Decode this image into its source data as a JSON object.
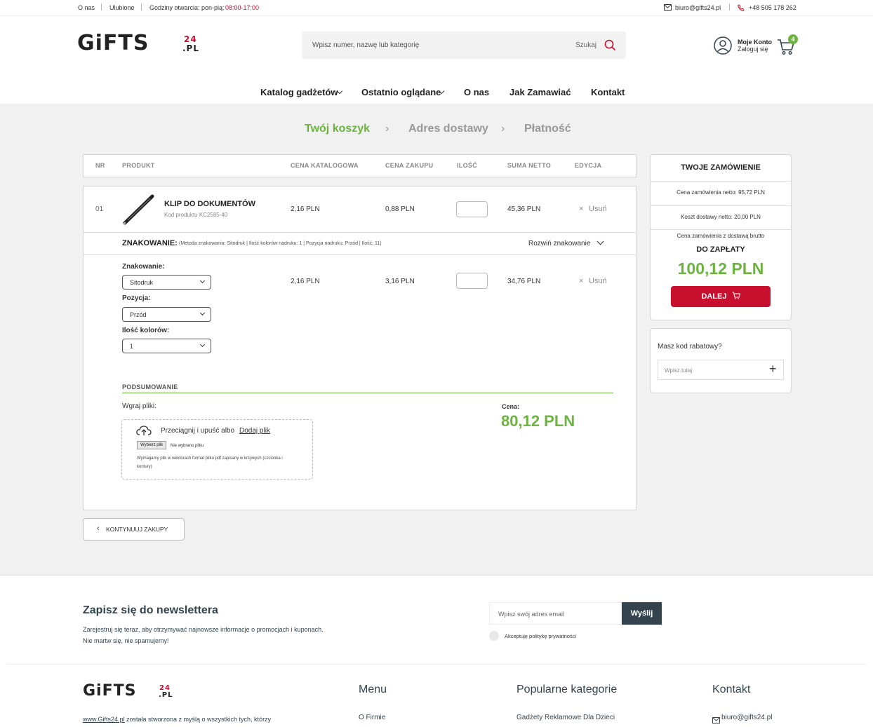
{
  "topbar": {
    "links": [
      "O nas",
      "Ulubione"
    ],
    "hours_label": "Godziny otwarcia: pon-pią:",
    "hours_value": "08:00-17:00",
    "email": "biuro@gifts24.pl",
    "phone": "+48 505 178 262"
  },
  "header": {
    "logo_main": "GiFTS",
    "logo_num": "24",
    "logo_pl": ".PL",
    "search_placeholder": "Wpisz numer, nazwę lub kategorię",
    "search_button": "Szukaj",
    "account_title": "Moje Konto",
    "account_sub": "Zaloguj się",
    "cart_count": "4"
  },
  "nav": [
    "Katalog gadżetów",
    "Ostatnio oglądane",
    "O nas",
    "Jak Zamawiać",
    "Kontakt"
  ],
  "steps": [
    "Twój koszyk",
    "Adres dostawy",
    "Płatność"
  ],
  "table": {
    "headers": [
      "NR",
      "PRODUKT",
      "CENA KATALOGOWA",
      "CENA ZAKUPU",
      "ILOŚĆ",
      "SUMA NETTO",
      "EDYCJA"
    ],
    "row": {
      "nr": "01",
      "name": "KLIP DO DOKUMENTÓW",
      "code": "Kod produktu KC2585-40",
      "catalog_price": "2,16 PLN",
      "purchase_price": "0,88 PLN",
      "sum": "45,36 PLN",
      "remove": "Usuń"
    },
    "marking": {
      "label": "ZNAKOWANIE:",
      "details": "(Metoda znakowania: Sitodruk | Ilość kolorów nadruku: 1 | Pozycja nadruku: Przód | Ilość: 11)",
      "expand": "Rozwiń znakowanie",
      "f1_label": "Znakowanie:",
      "f1_value": "Sitodruk",
      "f2_label": "Pozycja:",
      "f2_value": "Przód",
      "f3_label": "Ilość kolorów:",
      "f3_value": "1",
      "catalog_price": "2,16 PLN",
      "purchase_price": "3,16 PLN",
      "sum": "34,76 PLN",
      "remove": "Usuń"
    },
    "summary": {
      "title": "PODSUMOWANIE",
      "upload_label": "Wgraj pliki:",
      "drop_text": "Przeciągnij i upuść albo",
      "drop_link": "Dodaj plik",
      "choose_btn": "Wybierz plik",
      "no_file": "Nie wybrano pliku",
      "note_1": "Wymagamy plik w wektorach format pliku pdf zapisany w krzywych (czcionka i",
      "note_2": "kontury)",
      "price_label": "Cena:",
      "price": "80,12 PLN"
    },
    "continue": "KONTYNUUJ ZAKUPY"
  },
  "order": {
    "title": "TWOJE ZAMÓWIENIE",
    "net": "Cena zamówienia netto: 95,72 PLN",
    "delivery": "Koszt dostawy netto: 20,00 PLN",
    "gross_label": "Cena zamówienia z dostawą brutto",
    "pay_label": "DO ZAPŁATY",
    "total": "100,12 PLN",
    "button": "DALEJ"
  },
  "coupon": {
    "title": "Masz kod rabatowy?",
    "placeholder": "Wpisz tutaj"
  },
  "newsletter": {
    "title": "Zapisz się do newslettera",
    "line1": "Zarejestruj się teraz, aby otrzymywać najnowsze informacje o promocjach i kuponach.",
    "line2": "Nie martw się, nie spamujemy!",
    "placeholder": "Wpisz swój adres email",
    "button": "Wyślij",
    "privacy": "Akceptuję politykę prywatności"
  },
  "footer": {
    "site_link": "www.Gifts24.pl",
    "site_text": " została stworzona z myślą o wszystkich tych, którzy",
    "menu_title": "Menu",
    "menu_item": "O Firmie",
    "categories_title": "Popularne kategorie",
    "category_item": "Gadżety Reklamowe Dla Dzieci",
    "contact_title": "Kontakt",
    "contact_email": "biuro@gifts24.pl"
  },
  "colors": {
    "accent_green": "#6cb33f",
    "accent_red": "#c8102e",
    "dark": "#34444f"
  }
}
